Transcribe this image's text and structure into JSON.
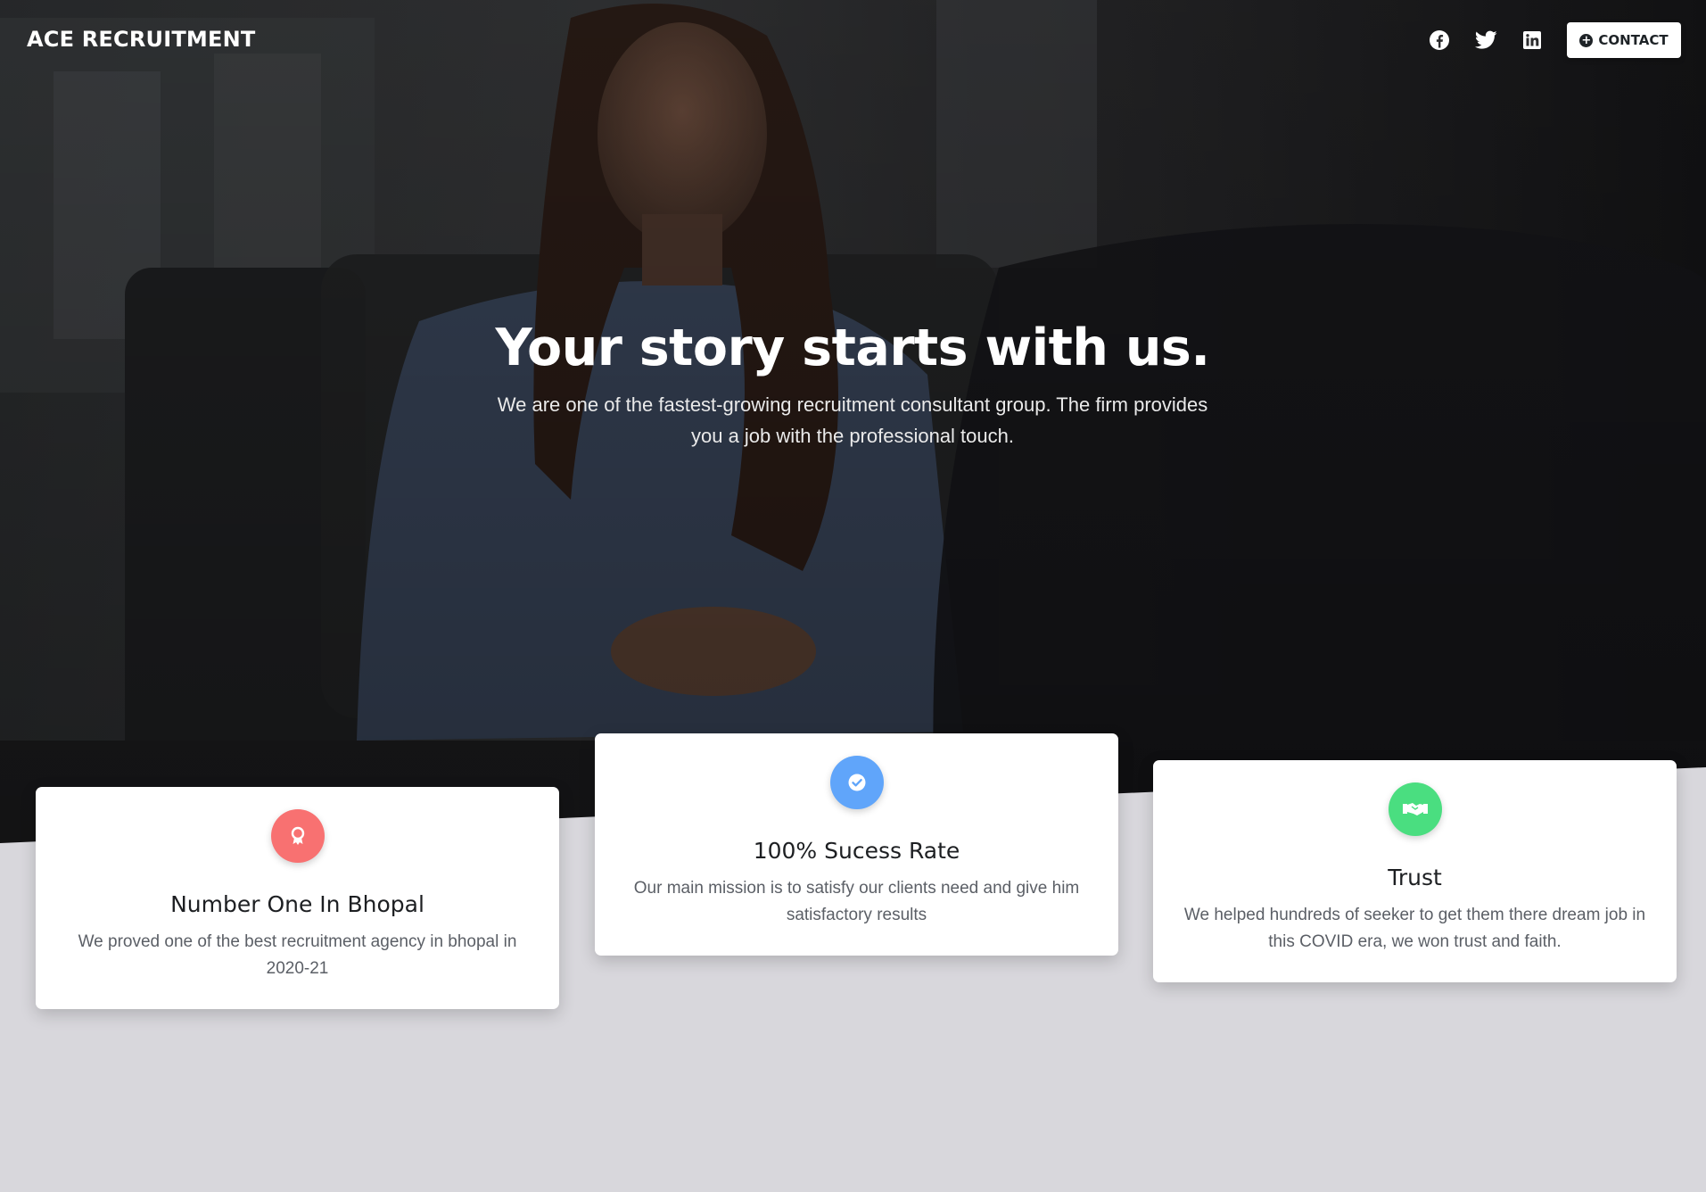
{
  "navbar": {
    "brand": "ACE RECRUITMENT",
    "social": [
      "facebook-icon",
      "twitter-icon",
      "linkedin-icon"
    ],
    "contact_label": "CONTACT"
  },
  "hero": {
    "title": "Your story starts with us.",
    "subtitle": "We are one of the fastest-growing recruitment consultant group. The firm provides you a job with the professional touch."
  },
  "features": [
    {
      "title": "Number One In Bhopal",
      "description": "We proved one of the best recruitment agency in bhopal in 2020-21",
      "icon": "award-icon",
      "color": "#f87171"
    },
    {
      "title": "100% Sucess Rate",
      "description": "Our main mission is to satisfy our clients need and give him satisfactory results",
      "icon": "check-icon",
      "color": "#60a5fa"
    },
    {
      "title": "Trust",
      "description": "We helped hundreds of seeker to get them there dream job in this COVID era, we won trust and faith.",
      "icon": "handshake-icon",
      "color": "#4ade80"
    }
  ],
  "colors": {
    "page_background": "#d8d7dc",
    "hero_overlay": "#1c1b1d",
    "card_background": "#ffffff"
  }
}
